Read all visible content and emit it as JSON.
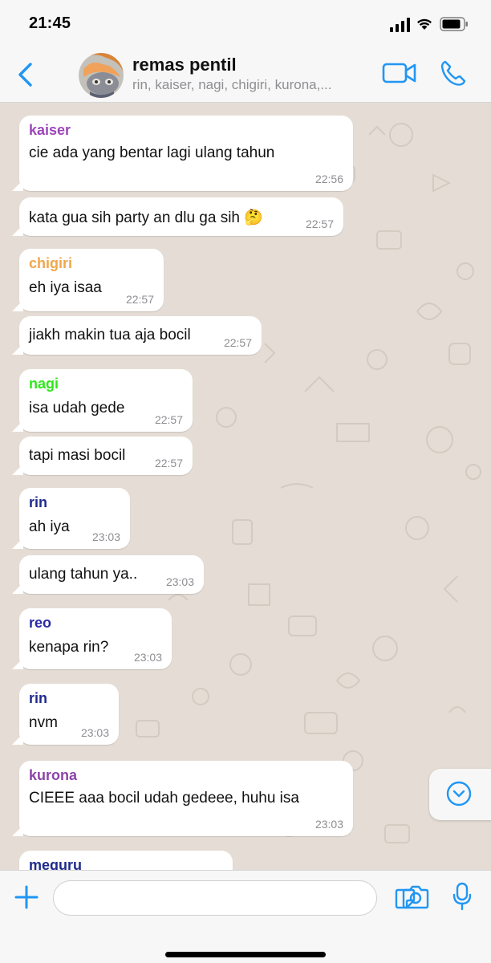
{
  "status_bar": {
    "time": "21:45"
  },
  "header": {
    "group_name": "remas pentil",
    "members": "rin, kaiser, nagi, chigiri, kurona,..."
  },
  "colors": {
    "accent": "#2196f3",
    "kaiser": "#9c46b8",
    "chigiri": "#f0a64a",
    "nagi": "#2ee81a",
    "rin": "#1f2a8c",
    "reo": "#2a2aa8",
    "kurona": "#8c44a8",
    "meguru": "#1f2a8c"
  },
  "messages": [
    {
      "sender": "kaiser",
      "text": "cie ada yang bentar lagi ulang tahun",
      "time": "22:56"
    },
    {
      "sender": "",
      "text": "kata gua sih party an dlu ga sih",
      "emoji": "🤔",
      "time": "22:57"
    },
    {
      "sender": "chigiri",
      "text": "eh iya isaa",
      "time": "22:57"
    },
    {
      "sender": "",
      "text": "jiakh makin tua aja bocil",
      "time": "22:57"
    },
    {
      "sender": "nagi",
      "text": "isa udah gede",
      "time": "22:57"
    },
    {
      "sender": "",
      "text": "tapi masi bocil",
      "time": "22:57"
    },
    {
      "sender": "rin",
      "text": "ah iya",
      "time": "23:03"
    },
    {
      "sender": "",
      "text": "ulang tahun ya..",
      "time": "23:03"
    },
    {
      "sender": "reo",
      "text": "kenapa rin?",
      "time": "23:03"
    },
    {
      "sender": "rin",
      "text": "nvm",
      "time": "23:03"
    },
    {
      "sender": "kurona",
      "text": "CIEEE aaa bocil udah gedeee, huhu isa",
      "time": "23:03"
    },
    {
      "sender": "meguru",
      "text": "",
      "time": ""
    }
  ],
  "input": {
    "placeholder": ""
  },
  "icons": {
    "back": "chevron-left-icon",
    "video": "video-camera-icon",
    "call": "phone-icon",
    "plus": "plus-icon",
    "sticker": "sticker-icon",
    "camera": "camera-icon",
    "mic": "microphone-icon",
    "scroll": "chevron-down-circle-icon"
  }
}
